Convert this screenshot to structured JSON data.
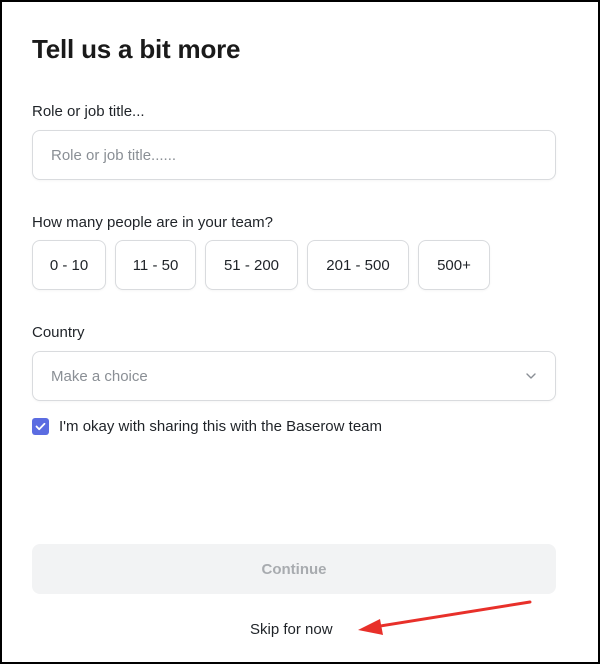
{
  "form": {
    "title": "Tell us a bit more",
    "role": {
      "label": "Role or job title...",
      "placeholder": "Role or job title......",
      "value": ""
    },
    "team_size": {
      "label": "How many people are in your team?",
      "options": [
        "0 - 10",
        "11 - 50",
        "51 - 200",
        "201 - 500",
        "500+"
      ]
    },
    "country": {
      "label": "Country",
      "placeholder": "Make a choice",
      "icon": "chevron-down-icon"
    },
    "consent": {
      "checked": true,
      "label": "I'm okay with sharing this with the Baserow team"
    },
    "continue_label": "Continue",
    "skip_label": "Skip for now"
  },
  "colors": {
    "accent": "#5b6ce1",
    "annotation_arrow": "#e8302a",
    "disabled_button_bg": "#f2f3f4",
    "disabled_button_text": "#a8abaf"
  }
}
